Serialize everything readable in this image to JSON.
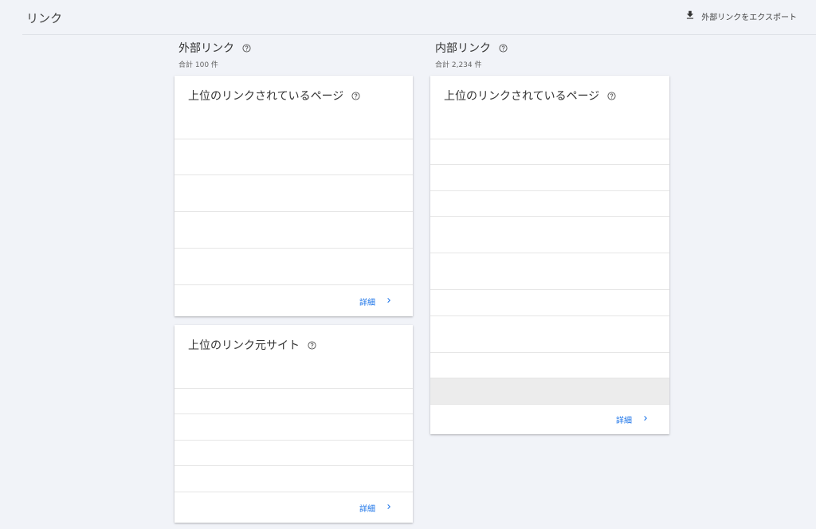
{
  "page": {
    "title": "リンク",
    "export_label": "外部リンクをエクスポート"
  },
  "external": {
    "heading": "外部リンク",
    "total": "合計 100 件",
    "top_pages_card": {
      "title": "上位のリンクされているページ",
      "more": "詳細"
    },
    "top_sites_card": {
      "title": "上位のリンク元サイト",
      "more": "詳細"
    }
  },
  "internal": {
    "heading": "内部リンク",
    "total": "合計 2,234 件",
    "top_pages_card": {
      "title": "上位のリンクされているページ",
      "more": "詳細"
    }
  },
  "icons": {
    "export": "download-icon",
    "help": "help-circle-icon",
    "more": "chevron-right-icon"
  },
  "colors": {
    "background": "#f1f3f8",
    "link": "#1a73e8",
    "card": "#ffffff"
  }
}
